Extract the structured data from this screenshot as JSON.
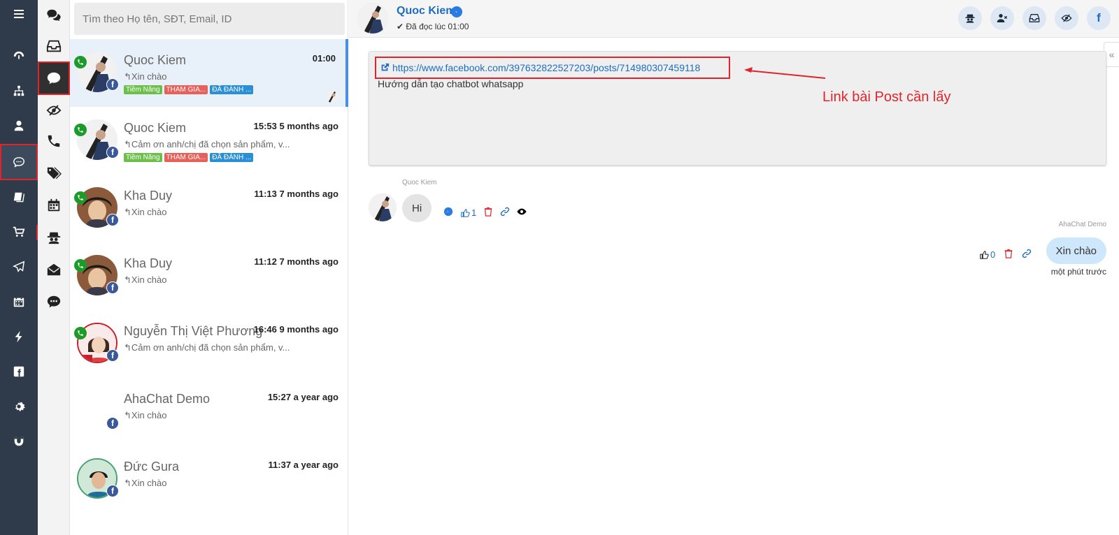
{
  "search": {
    "placeholder": "Tìm theo Họ tên, SĐT, Email, ID"
  },
  "conversations": [
    {
      "name": "Quoc Kiem",
      "time": "01:00",
      "preview": "Xin chào",
      "tags": [
        {
          "label": "Tiềm Năng",
          "color": "#6cc04a"
        },
        {
          "label": "THAM GIA...",
          "color": "#e8605a"
        },
        {
          "label": "ĐÃ ĐÁNH ...",
          "color": "#2b8fd6"
        }
      ]
    },
    {
      "name": "Quoc Kiem",
      "time": "15:53 5 months ago",
      "preview": "Cảm ơn anh/chị đã chọn sản phẩm, v...",
      "tags": [
        {
          "label": "Tiềm Năng",
          "color": "#6cc04a"
        },
        {
          "label": "THAM GIA...",
          "color": "#e8605a"
        },
        {
          "label": "ĐÃ ĐÁNH ...",
          "color": "#2b8fd6"
        }
      ]
    },
    {
      "name": "Kha Duy",
      "time": "11:13 7 months ago",
      "preview": "Xin chào",
      "tags": []
    },
    {
      "name": "Kha Duy",
      "time": "11:12 7 months ago",
      "preview": "Xin chào",
      "tags": []
    },
    {
      "name": "Nguyễn Thị Việt Phương",
      "time": "16:46 9 months ago",
      "preview": "Cảm ơn anh/chị đã chọn sản phẩm, v...",
      "tags": []
    },
    {
      "name": "AhaChat Demo",
      "time": "15:27 a year ago",
      "preview": "Xin chào",
      "tags": []
    },
    {
      "name": "Đức Gura",
      "time": "11:37 a year ago",
      "preview": "Xin chào",
      "tags": []
    }
  ],
  "header": {
    "name": "Quoc Kiem",
    "status": "Đã đọc lúc 01:00",
    "fb_letter": "f"
  },
  "post": {
    "link": "https://www.facebook.com/397632822527203/posts/714980307459118",
    "description": "Hướng dẫn tạo chatbot whatsapp"
  },
  "annotation": {
    "text": "Link bài Post cần lấy",
    "color": "#e0242b"
  },
  "messages": {
    "incoming": {
      "sender": "Quoc Kiem",
      "text": "Hi",
      "likes": "1"
    },
    "outgoing": {
      "sender": "AhaChat Demo",
      "text": "Xin chào",
      "likes": "0",
      "time": "một phút trước"
    }
  },
  "fb_badge": "f",
  "collapse_glyph": "«",
  "colors": {
    "rail_bg": "#2f3b4a",
    "accent_blue": "#1f6dbf",
    "highlight_red": "#e0242b",
    "active_row": "#e8f1f9"
  }
}
